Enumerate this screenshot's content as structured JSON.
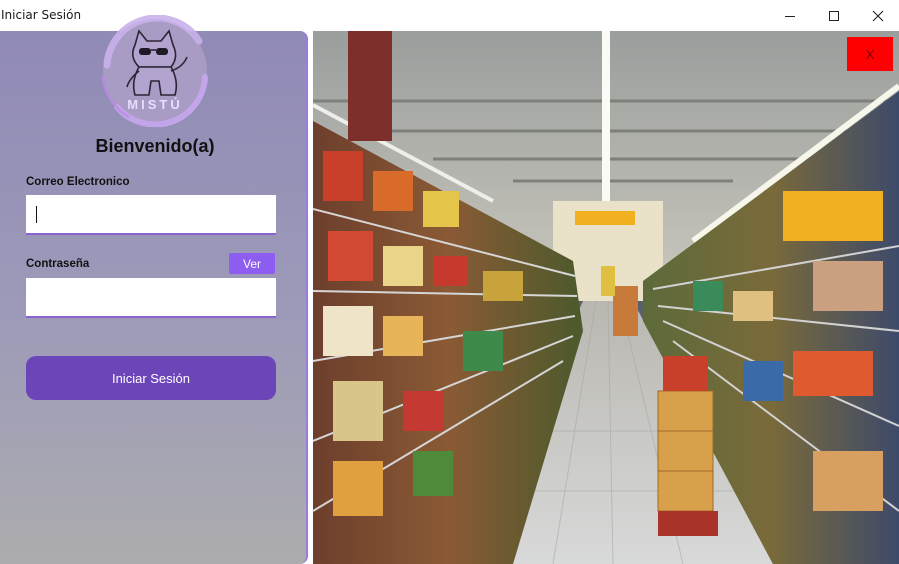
{
  "window": {
    "title": "Iniciar Sesión"
  },
  "login": {
    "brand": "MISTÚ",
    "welcome": "Bienvenido(a)",
    "email_label": "Correo Electronico",
    "email_value": "",
    "password_label": "Contraseña",
    "password_value": "",
    "show_password_label": "Ver",
    "submit_label": "Iniciar Sesión"
  },
  "banner": {
    "close_label": "X",
    "image_subject": "supermarket-aisle-photo"
  },
  "colors": {
    "accent": "#6c45b9",
    "show_button": "#8d5cf0",
    "close_button": "#ff0000",
    "field_underline": "#8a63d2"
  }
}
